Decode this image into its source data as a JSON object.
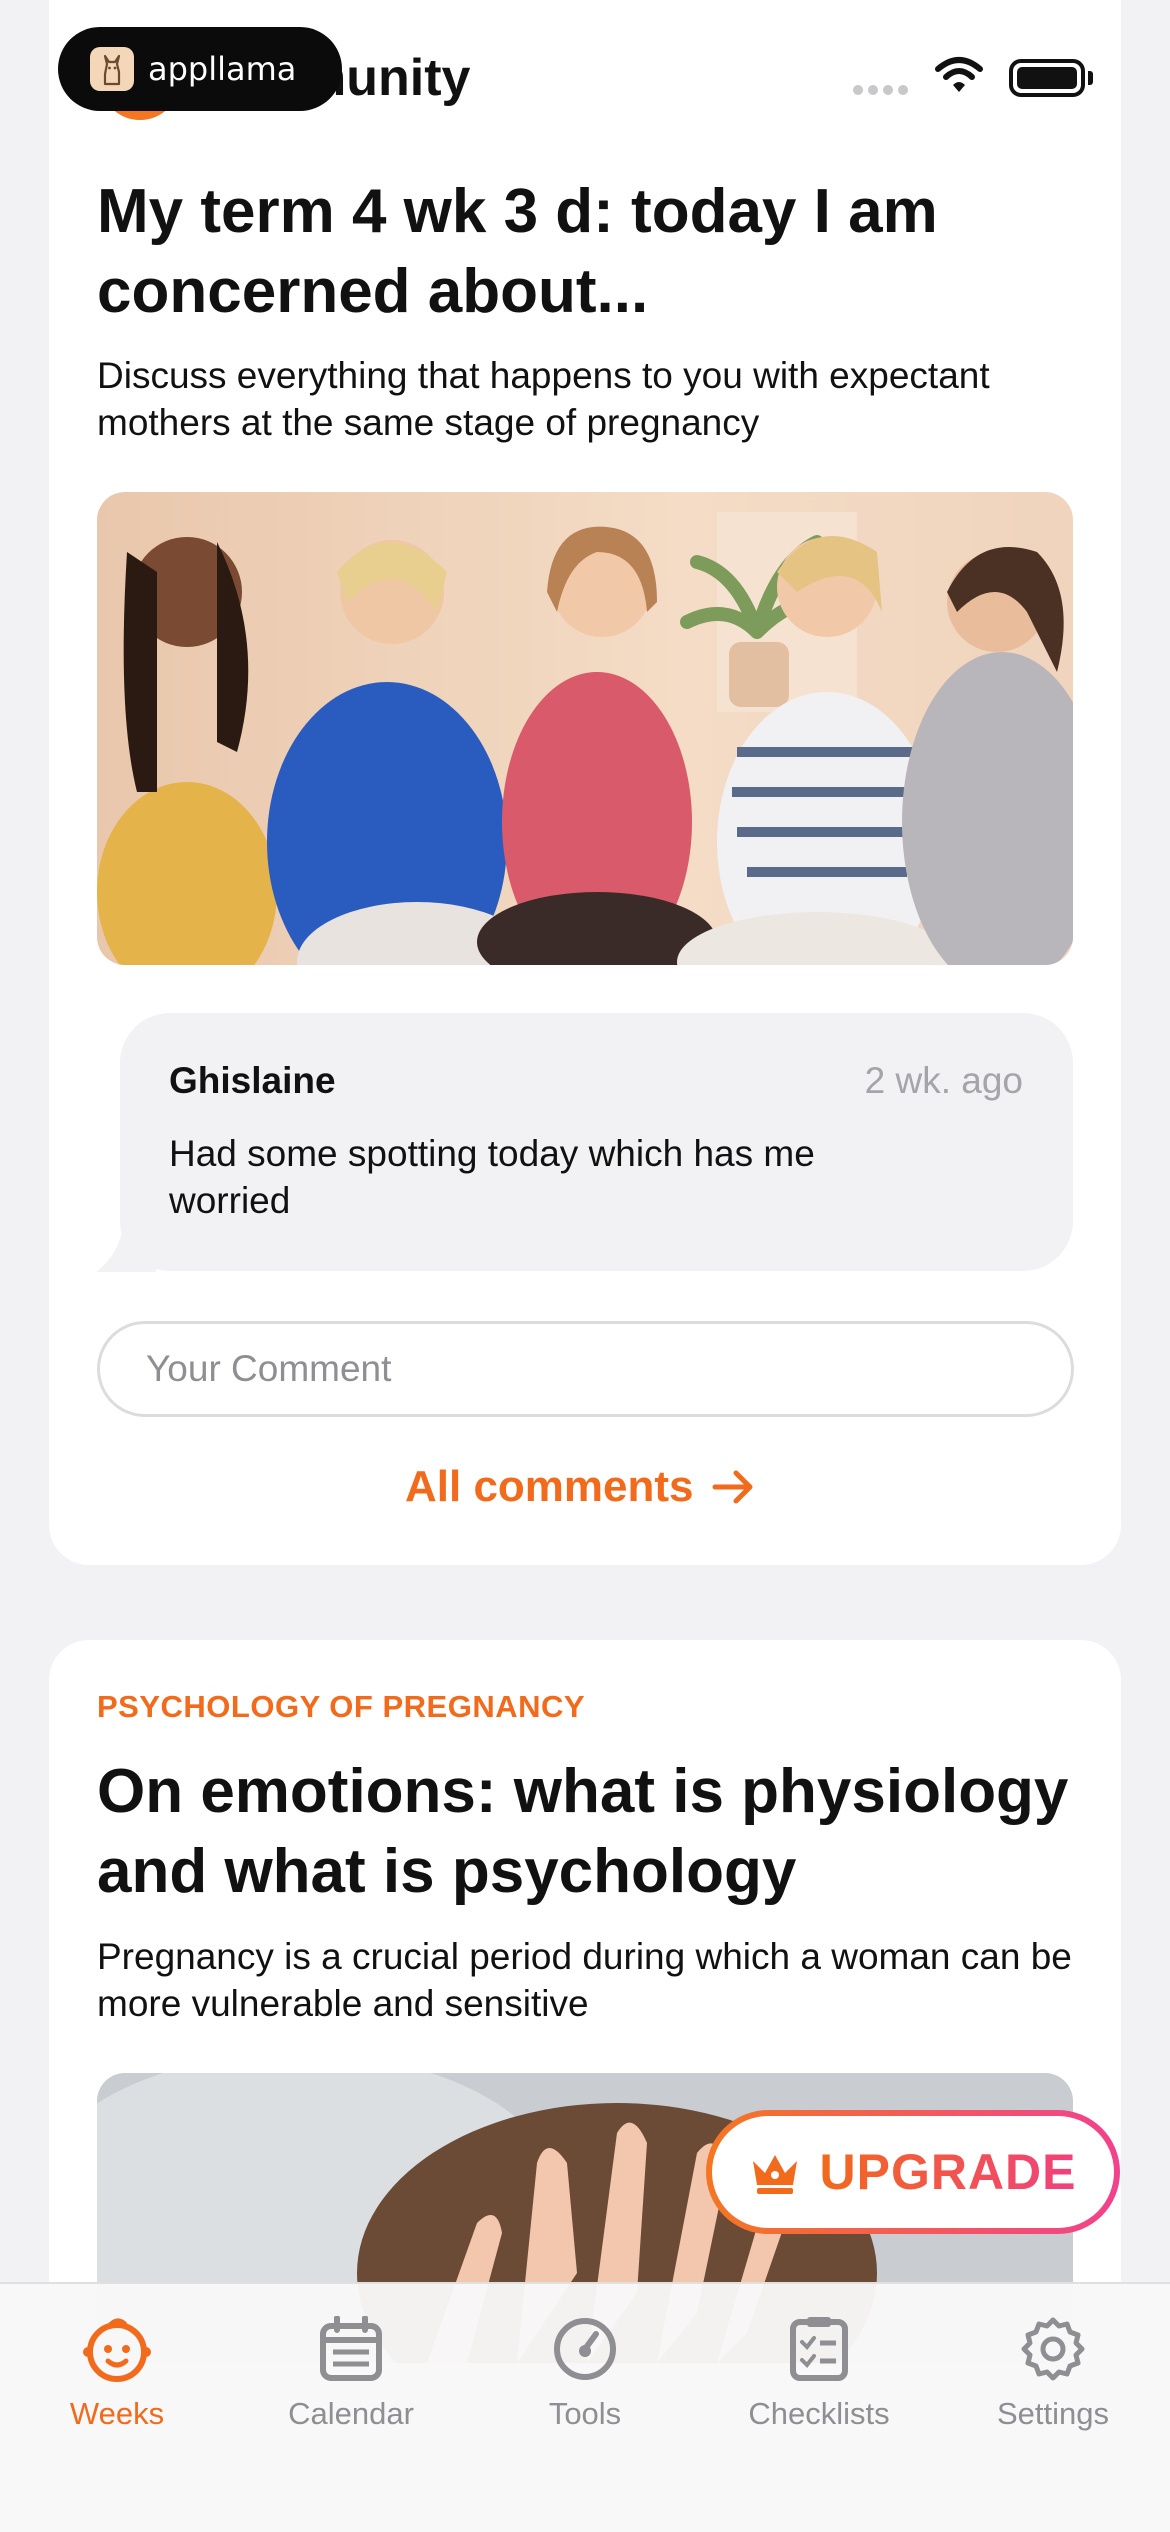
{
  "status_bar": {
    "badge_text": "appllama",
    "icons": [
      "cellular-signal-icon",
      "wifi-icon",
      "battery-icon"
    ]
  },
  "community_card": {
    "section_title": "munity",
    "post_title": "My term 4 wk 3 d: today I am concerned about...",
    "post_description": "Discuss everything that happens to you with expectant mothers at the same stage of pregnancy",
    "latest_comment": {
      "author": "Ghislaine",
      "time": "2 wk. ago",
      "text": "Had some spotting today which has me worried"
    },
    "comment_input": {
      "value": "",
      "placeholder": "Your Comment"
    },
    "all_comments_label": "All comments"
  },
  "article_card": {
    "category": "PSYCHOLOGY OF PREGNANCY",
    "title": "On emotions: what is physiology and what is psychology",
    "description": "Pregnancy is a crucial period during which a woman can be more vulnerable and sensitive"
  },
  "upgrade_button": {
    "label": "UPGRADE",
    "icon": "crown-icon"
  },
  "tab_bar": {
    "tabs": [
      {
        "label": "Weeks",
        "icon": "baby-face-icon",
        "active": true
      },
      {
        "label": "Calendar",
        "icon": "calendar-icon",
        "active": false
      },
      {
        "label": "Tools",
        "icon": "gauge-icon",
        "active": false
      },
      {
        "label": "Checklists",
        "icon": "checklist-icon",
        "active": false
      },
      {
        "label": "Settings",
        "icon": "gear-icon",
        "active": false
      }
    ]
  },
  "colors": {
    "accent": "#f26a1b",
    "upgrade_gradient_start": "#f47622",
    "upgrade_gradient_end": "#f2418e",
    "inactive_tab": "#8e8e93",
    "background": "#f2f2f4"
  }
}
